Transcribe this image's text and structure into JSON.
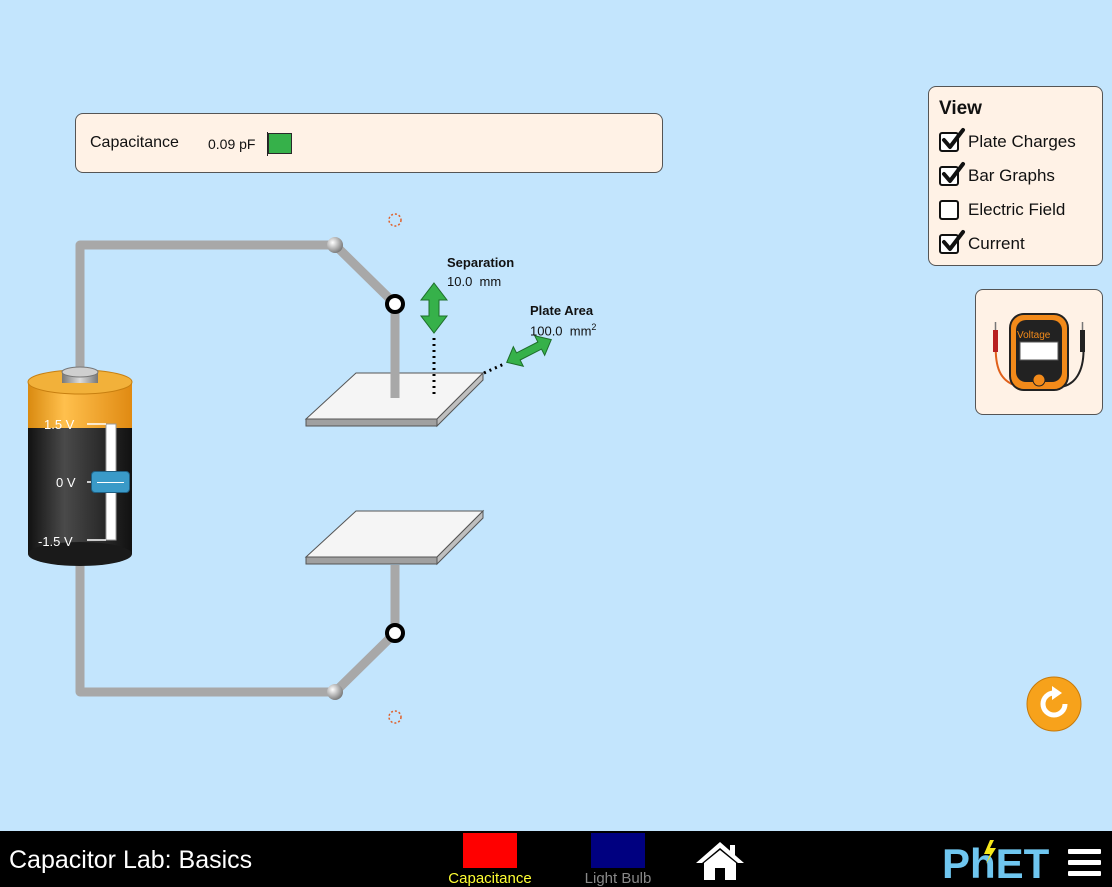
{
  "capacitance": {
    "label": "Capacitance",
    "value": "0.09 pF"
  },
  "view_panel": {
    "title": "View",
    "options": [
      {
        "label": "Plate Charges",
        "checked": true
      },
      {
        "label": "Bar Graphs",
        "checked": true
      },
      {
        "label": "Electric Field",
        "checked": false
      },
      {
        "label": "Current",
        "checked": true
      }
    ]
  },
  "voltmeter": {
    "label": "Voltage"
  },
  "separation": {
    "label": "Separation",
    "value": "10.0  mm"
  },
  "plate_area": {
    "label": "Plate Area",
    "value": "100.0  mm",
    "unit_exponent": "2"
  },
  "battery": {
    "tick_max": "1.5 V",
    "tick_zero": "0 V",
    "tick_min": "-1.5 V",
    "voltage": 0
  },
  "navbar": {
    "title": "Capacitor Lab: Basics",
    "screens": [
      {
        "label": "Capacitance",
        "selected": true,
        "icon_color": "#ff0000"
      },
      {
        "label": "Light Bulb",
        "selected": false,
        "icon_color": "#000080"
      }
    ],
    "logo_text": "PhET"
  },
  "colors": {
    "background": "#c3e5fd",
    "panel": "#fff2e6",
    "selected_screen_label": "#ffff33",
    "unselected_screen_label": "#888888",
    "arrow_green": "#36b14a",
    "battery_orange": "#f7a21b",
    "reset_orange": "#f7a21b",
    "logo_blue": "#6fc6f0"
  },
  "icons": {
    "checkbox": "check-icon",
    "home": "home-icon",
    "reset": "reset-all-icon",
    "menu": "hamburger-icon"
  }
}
